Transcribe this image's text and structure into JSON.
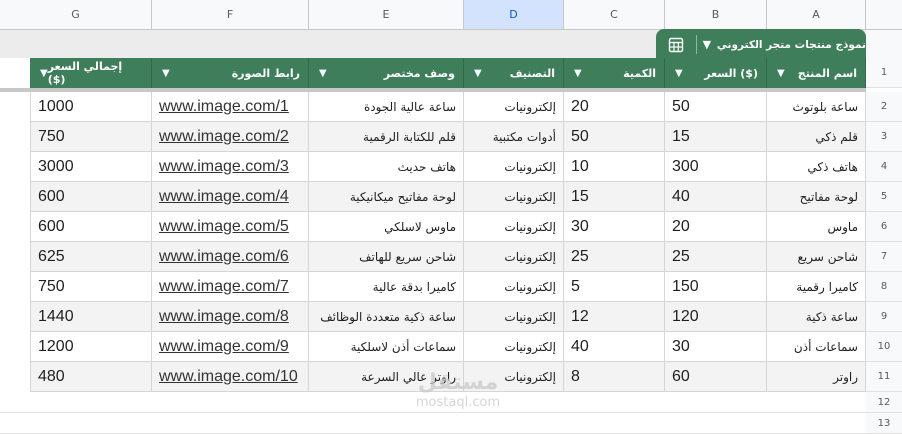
{
  "column_letters": [
    "G",
    "F",
    "E",
    "D",
    "C",
    "B",
    "A"
  ],
  "selected_column": "D",
  "table_tab": {
    "name": "نموذج منتجات متجر الكتروني",
    "icon": "table-grid-icon"
  },
  "headers": {
    "total": "إجمالي السعر ($)",
    "image": "رابط الصورة",
    "desc": "وصف مختصر",
    "category": "التصنيف",
    "qty": "الكمية",
    "price": "السعر ($)",
    "name": "اسم المنتج"
  },
  "row_numbers": [
    "1",
    "2",
    "3",
    "4",
    "5",
    "6",
    "7",
    "8",
    "9",
    "10",
    "11",
    "12",
    "13"
  ],
  "rows": [
    {
      "name": "ساعة بلوتوث",
      "price": "50",
      "qty": "20",
      "category": "إلكترونيات",
      "desc": "ساعة عالية الجودة",
      "image": "www.image.com/1",
      "total": "1000"
    },
    {
      "name": "قلم ذكي",
      "price": "15",
      "qty": "50",
      "category": "أدوات مكتبية",
      "desc": "قلم للكتابة الرقمية",
      "image": "www.image.com/2",
      "total": "750"
    },
    {
      "name": "هاتف ذكي",
      "price": "300",
      "qty": "10",
      "category": "إلكترونيات",
      "desc": "هاتف حديث",
      "image": "www.image.com/3",
      "total": "3000"
    },
    {
      "name": "لوحة مفاتيح",
      "price": "40",
      "qty": "15",
      "category": "إلكترونيات",
      "desc": "لوحة مفاتيح ميكانيكية",
      "image": "www.image.com/4",
      "total": "600"
    },
    {
      "name": "ماوس",
      "price": "20",
      "qty": "30",
      "category": "إلكترونيات",
      "desc": "ماوس لاسلكي",
      "image": "www.image.com/5",
      "total": "600"
    },
    {
      "name": "شاحن سريع",
      "price": "25",
      "qty": "25",
      "category": "إلكترونيات",
      "desc": "شاحن سريع للهاتف",
      "image": "www.image.com/6",
      "total": "625"
    },
    {
      "name": "كاميرا رقمية",
      "price": "150",
      "qty": "5",
      "category": "إلكترونيات",
      "desc": "كاميرا بدقة عالية",
      "image": "www.image.com/7",
      "total": "750"
    },
    {
      "name": "ساعة ذكية",
      "price": "120",
      "qty": "12",
      "category": "إلكترونيات",
      "desc": "ساعة ذكية متعددة الوظائف",
      "image": "www.image.com/8",
      "total": "1440"
    },
    {
      "name": "سماعات أذن",
      "price": "30",
      "qty": "40",
      "category": "إلكترونيات",
      "desc": "سماعات أذن لاسلكية",
      "image": "www.image.com/9",
      "total": "1200"
    },
    {
      "name": "راوتر",
      "price": "60",
      "qty": "8",
      "category": "إلكترونيات",
      "desc": "راوتر عالي السرعة",
      "image": "www.image.com/10",
      "total": "480"
    }
  ],
  "watermark": {
    "main": "مستقل",
    "sub": "mostaql.com"
  }
}
